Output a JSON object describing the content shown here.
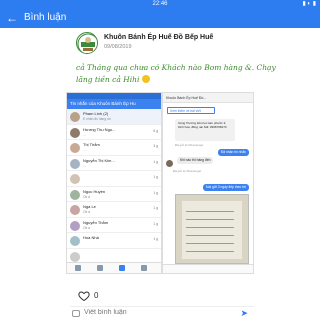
{
  "status_bar": {
    "time": "22:46",
    "icons": "▮ ◐ ▮"
  },
  "app_bar": {
    "title": "Bình luận"
  },
  "post": {
    "author": "Khuôn Bánh Ép Huế Đồ Bếp Huế",
    "date": "09/08/2019",
    "caption": "cả Tháng qua chưa có Khách nào Bom hàng &. Chạy lãng tiền cả Hihi"
  },
  "shot_left": {
    "title": "Tin nhắn của Khuôn Bánh Ép Hu",
    "rows": [
      {
        "name": "Pham Linh (2)",
        "msg": "E nhận đc hàng rồi",
        "time": "",
        "active": true
      },
      {
        "name": "Hương Thu Ngọ...",
        "msg": "...",
        "time": "6 g"
      },
      {
        "name": "Thị Thắm",
        "msg": "...",
        "time": "3 g"
      },
      {
        "name": "Nguyễn Thị Kim...",
        "msg": "...",
        "time": "1 g"
      },
      {
        "name": "",
        "msg": "",
        "time": "1 g"
      },
      {
        "name": "Ngọc Huyền",
        "msg": "Ok a",
        "time": "1 g"
      },
      {
        "name": "Nga Le",
        "msg": "Ok a",
        "time": "1 g"
      },
      {
        "name": "Nguyễn Thắm",
        "msg": "Ok a",
        "time": "1 g"
      },
      {
        "name": "Hoa Nhà",
        "msg": "",
        "time": "1 g"
      },
      {
        "name": "",
        "msg": "",
        "time": ""
      }
    ]
  },
  "shot_right": {
    "header": "Khuôn Bánh Ép Huế Đồ...",
    "chip": "Xem thêm về bài viết",
    "card": "Cộng Trương tiểu học tam phước 3, bình hòa, đồng nai Sdt: 0396768174",
    "via": "Đã gửi từ Messenger",
    "bubble1": "Đã nhận tin nhắn",
    "bubble2": "Khi nào thì hàng đến",
    "via2": "Đã gửi từ Messenger",
    "bubble3": "Mai gửi 3 ngày tiếp theo tới"
  },
  "bottom": {
    "likes": "0",
    "comment_placeholder": "Viết bình luận"
  }
}
